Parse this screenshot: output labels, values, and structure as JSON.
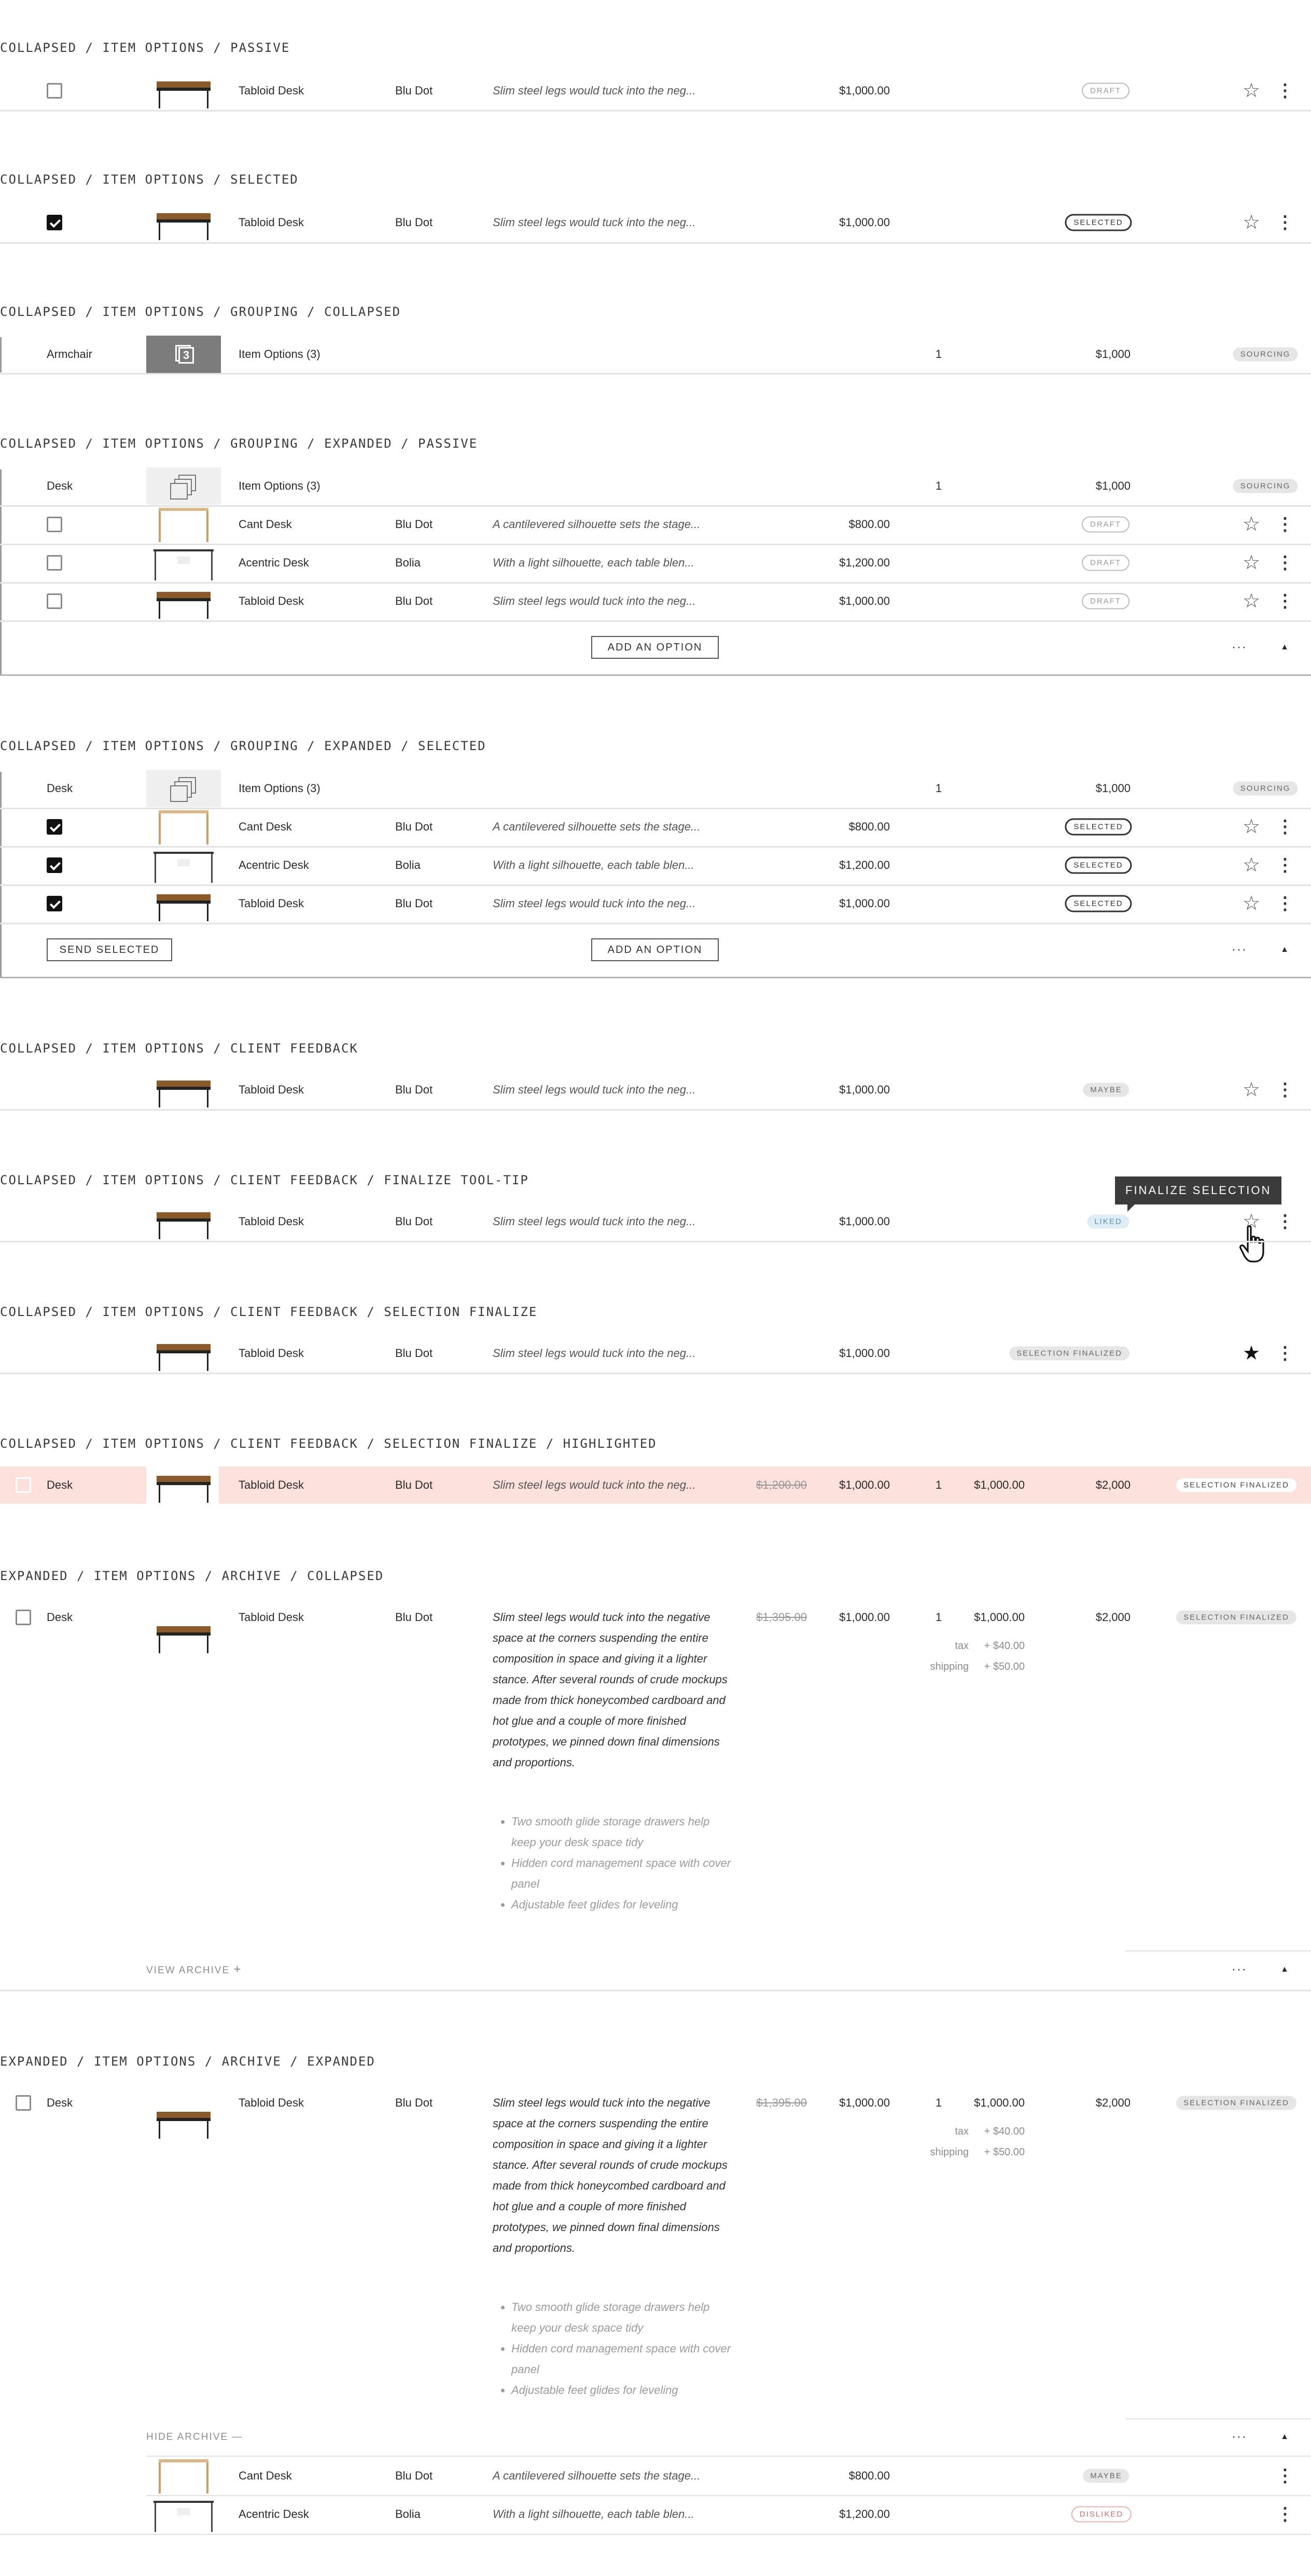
{
  "sections": [
    {
      "title": "COLLAPSED / ITEM OPTIONS / PASSIVE"
    },
    {
      "title": "COLLAPSED / ITEM OPTIONS / SELECTED"
    },
    {
      "title": "COLLAPSED / ITEM OPTIONS / GROUPING / COLLAPSED"
    },
    {
      "title": "COLLAPSED / ITEM OPTIONS / GROUPING / EXPANDED / PASSIVE"
    },
    {
      "title": "COLLAPSED / ITEM OPTIONS / GROUPING / EXPANDED / SELECTED"
    },
    {
      "title": "COLLAPSED / ITEM OPTIONS / CLIENT FEEDBACK"
    },
    {
      "title": "COLLAPSED / ITEM OPTIONS / CLIENT FEEDBACK / FINALIZE TOOL-TIP"
    },
    {
      "title": "COLLAPSED / ITEM OPTIONS / CLIENT FEEDBACK / SELECTION FINALIZE"
    },
    {
      "title": "COLLAPSED / ITEM OPTIONS / CLIENT FEEDBACK / SELECTION FINALIZE / HIGHLIGHTED"
    },
    {
      "title": "EXPANDED / ITEM OPTIONS / ARCHIVE / COLLAPSED"
    },
    {
      "title": "EXPANDED / ITEM OPTIONS / ARCHIVE / EXPANDED"
    }
  ],
  "products": {
    "tabloid": {
      "name": "Tabloid Desk",
      "vendor": "Blu Dot",
      "desc": "Slim steel legs would tuck into the neg...",
      "price": "$1,000.00"
    },
    "cant": {
      "name": "Cant Desk",
      "vendor": "Blu Dot",
      "desc": "A cantilevered silhouette sets the stage...",
      "price": "$800.00"
    },
    "acentric_bolia": {
      "name": "Acentric Desk",
      "vendor": "Bolia",
      "desc": "With a light silhouette, each table blen...",
      "price": "$1,200.00"
    },
    "acentric_bludot": {
      "name": "Acentric Desk",
      "vendor": "Blu Dot",
      "desc": "With a light silhouette, each table blen...",
      "price": "$1,200.00"
    }
  },
  "badges": {
    "draft": "DRAFT",
    "selected": "SELECTED",
    "sourcing": "SOURCING",
    "maybe": "MAYBE",
    "liked": "LIKED",
    "disliked": "DISLIKED",
    "selection_finalized": "SELECTION FINALIZED"
  },
  "grouping": {
    "armchair": "Armchair",
    "desk": "Desk",
    "options_label": "Item Options (3)",
    "count_badge": "3",
    "qty": "1",
    "total": "$1,000"
  },
  "buttons": {
    "add_option": "ADD AN OPTION",
    "send_selected": "SEND SELECTED",
    "view_archive": "VIEW ARCHIVE",
    "view_archive_icon": "+",
    "hide_archive": "HIDE ARCHIVE",
    "hide_archive_icon": "—"
  },
  "tooltip": {
    "text": "FINALIZE SELECTION"
  },
  "highlighted": {
    "category": "Desk",
    "name": "Tabloid Desk",
    "vendor": "Blu Dot",
    "desc": "Slim steel legs would tuck into the neg...",
    "original_price": "$1,200.00",
    "price": "$1,000.00",
    "qty": "1",
    "subtotal": "$1,000.00",
    "total": "$2,000"
  },
  "expanded": {
    "category": "Desk",
    "name": "Tabloid Desk",
    "vendor": "Blu Dot",
    "description": "Slim steel legs would tuck into the negative space at the corners suspending the entire composition in space and giving it a lighter stance. After several rounds of crude mockups made from thick honeycombed cardboard and hot glue and a couple of more finished prototypes, we pinned down final dimensions and proportions.",
    "bullets": [
      "Two smooth glide storage drawers help keep your desk space tidy",
      "Hidden cord management space with cover panel",
      "Adjustable feet glides for leveling"
    ],
    "original_price": "$1,395.00",
    "price": "$1,000.00",
    "qty": "1",
    "subtotal": "$1,000.00",
    "tax_label": "tax",
    "tax": "+ $40.00",
    "shipping_label": "shipping",
    "shipping": "+ $50.00",
    "total": "$2,000"
  },
  "icons": {
    "star": "☆",
    "star_filled": "★",
    "kebab": "⋮",
    "more": "···",
    "caret_up": "▲"
  }
}
